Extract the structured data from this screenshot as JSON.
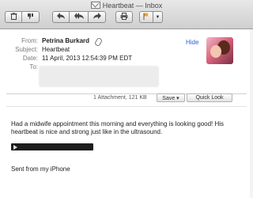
{
  "window": {
    "title": "Heartbeat — Inbox"
  },
  "toolbar": {
    "delete_icon": "trash-icon",
    "junk_icon": "thumbs-down-icon",
    "reply_icon": "reply-arrow-icon",
    "reply_all_icon": "reply-all-arrow-icon",
    "forward_icon": "forward-arrow-icon",
    "print_icon": "printer-icon",
    "flag_icon": "flag-icon",
    "flag_color": "#f0a21a"
  },
  "header": {
    "from_label": "From:",
    "from_value": "Petrina Burkard",
    "subject_label": "Subject:",
    "subject_value": "Heartbeat",
    "date_label": "Date:",
    "date_value": "11 April, 2013 12:54:39 PM EDT",
    "to_label": "To:",
    "hide_link": "Hide"
  },
  "attachments": {
    "summary": "1 Attachment, 121 KB",
    "save_label": "Save ▾",
    "quicklook_label": "Quick Look"
  },
  "message": {
    "body": "Had a midwife appointment this morning and everything is looking good! His heartbeat is nice and strong just like in the ultrasound.",
    "signature": "Sent from my iPhone"
  }
}
